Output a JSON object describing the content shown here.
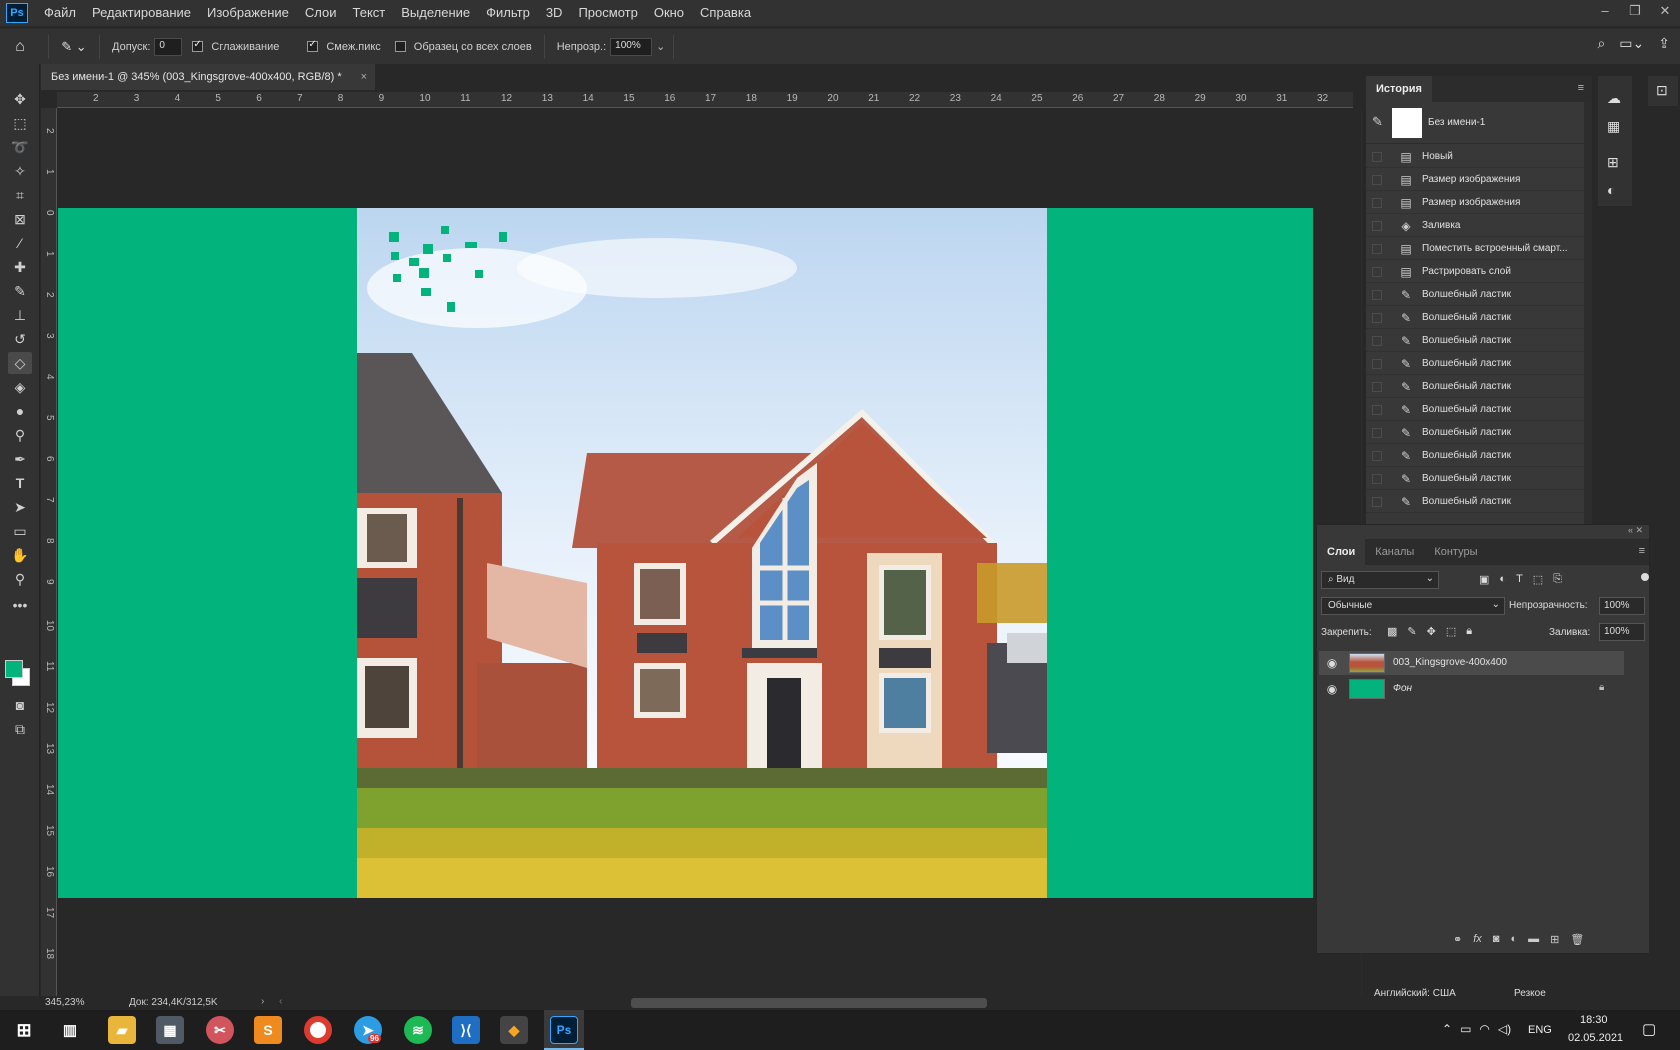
{
  "app": {
    "logo": "Ps"
  },
  "menu": [
    "Файл",
    "Редактирование",
    "Изображение",
    "Слои",
    "Текст",
    "Выделение",
    "Фильтр",
    "3D",
    "Просмотр",
    "Окно",
    "Справка"
  ],
  "options": {
    "tolerance_label": "Допуск:",
    "tolerance_value": "0",
    "antialias_label": "Сглаживание",
    "antialias_checked": true,
    "contiguous_label": "Смеж.пикс",
    "contiguous_checked": true,
    "sample_all_label": "Образец со всех слоев",
    "sample_all_checked": false,
    "opacity_label": "Непрозр.:",
    "opacity_value": "100%"
  },
  "document": {
    "tab_title": "Без имени-1 @ 345% (003_Kingsgrove-400x400, RGB/8) *",
    "close": "×"
  },
  "rulers": {
    "top": [
      "2",
      "3",
      "4",
      "5",
      "6",
      "7",
      "8",
      "9",
      "10",
      "11",
      "12",
      "13",
      "14",
      "15",
      "16",
      "17",
      "18",
      "19",
      "20",
      "21",
      "22",
      "23",
      "24",
      "25",
      "26",
      "27",
      "28",
      "29",
      "30",
      "31",
      "32"
    ],
    "left": [
      "2",
      "1",
      "0",
      "1",
      "2",
      "3",
      "4",
      "5",
      "6",
      "7",
      "8",
      "9",
      "10",
      "11",
      "12",
      "13",
      "14",
      "15",
      "16",
      "17",
      "18"
    ]
  },
  "status": {
    "zoom": "345,23%",
    "doc": "Док: 234,4K/312,5K"
  },
  "history": {
    "tab": "История",
    "snapshot_name": "Без имени-1",
    "items": [
      "Новый",
      "Размер изображения",
      "Размер изображения",
      "Заливка",
      "Поместить встроенный смарт...",
      "Растрировать слой",
      "Волшебный ластик",
      "Волшебный ластик",
      "Волшебный ластик",
      "Волшебный ластик",
      "Волшебный ластик",
      "Волшебный ластик",
      "Волшебный ластик",
      "Волшебный ластик",
      "Волшебный ластик",
      "Волшебный ластик"
    ]
  },
  "layers_panel": {
    "tabs": [
      "Слои",
      "Каналы",
      "Контуры"
    ],
    "filter_label": "Вид",
    "blend_mode": "Обычные",
    "opacity_label": "Непрозрачность:",
    "opacity_value": "100%",
    "lock_label": "Закрепить:",
    "fill_label": "Заливка:",
    "fill_value": "100%",
    "layers": [
      {
        "name": "003_Kingsgrove-400x400",
        "selected": true
      },
      {
        "name": "Фон",
        "selected": false
      }
    ]
  },
  "taskbar": {
    "tray_lang_ime": "Английский: США",
    "tray_sharp": "Резкое",
    "lang": "ENG",
    "time": "18:30",
    "date": "02.05.2021",
    "telegram_badge": "96"
  },
  "colors": {
    "canvas_green": "#02b47b",
    "foreground": "#02b47b",
    "background": "#ffffff",
    "accent_ps": "#31a8ff"
  }
}
